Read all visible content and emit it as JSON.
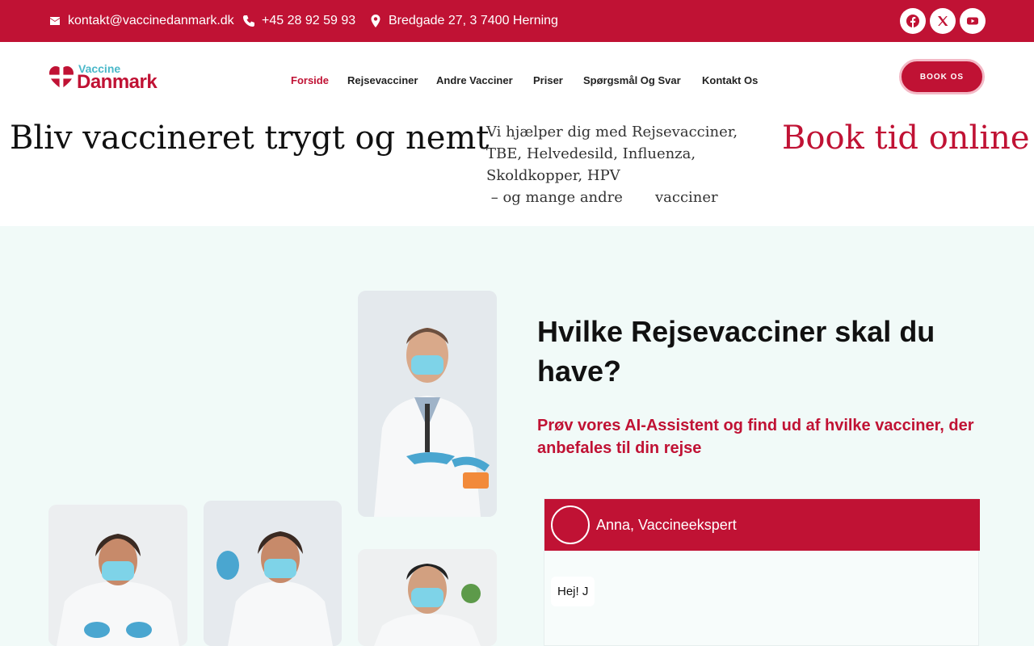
{
  "topbar": {
    "email": "kontakt@vaccinedanmark.dk",
    "phone": "+45 28 92 59 93",
    "address": "Bredgade 27, 3 7400 Herning",
    "icons": [
      "envelope-icon",
      "phone-icon",
      "location-pin-icon"
    ],
    "social": [
      "facebook-icon",
      "x-icon",
      "youtube-icon"
    ]
  },
  "logo": {
    "small": "Vaccine",
    "big": "Danmark"
  },
  "nav": {
    "items": [
      "Forside",
      "Rejsevacciner",
      "Andre Vacciner",
      "Priser",
      "Spørgsmål Og Svar",
      "Kontakt Os"
    ],
    "active": "Forside",
    "book_label": "BOOK OS"
  },
  "hero": {
    "headline": "Bliv vaccineret trygt og nemt",
    "desc_lines": [
      "Vi hjælper dig med Rejsevacciner,",
      "TBE, Helvedesild, Influenza,",
      "Skoldkopper, HPV",
      " – og mange andre       vacciner"
    ],
    "book_online": "Book tid online"
  },
  "section": {
    "title": "Hvilke Rejsevacciner skal du have?",
    "subtitle": "Prøv vores AI-Assistent og find ud af hvilke vacciner, der anbefales til din rejse"
  },
  "chat": {
    "agent_name": "Anna, Vaccineekspert",
    "message": "Hej! J"
  },
  "colors": {
    "brand": "#c01234",
    "accent": "#4ab8c9",
    "section_bg": "#f1faf8"
  }
}
